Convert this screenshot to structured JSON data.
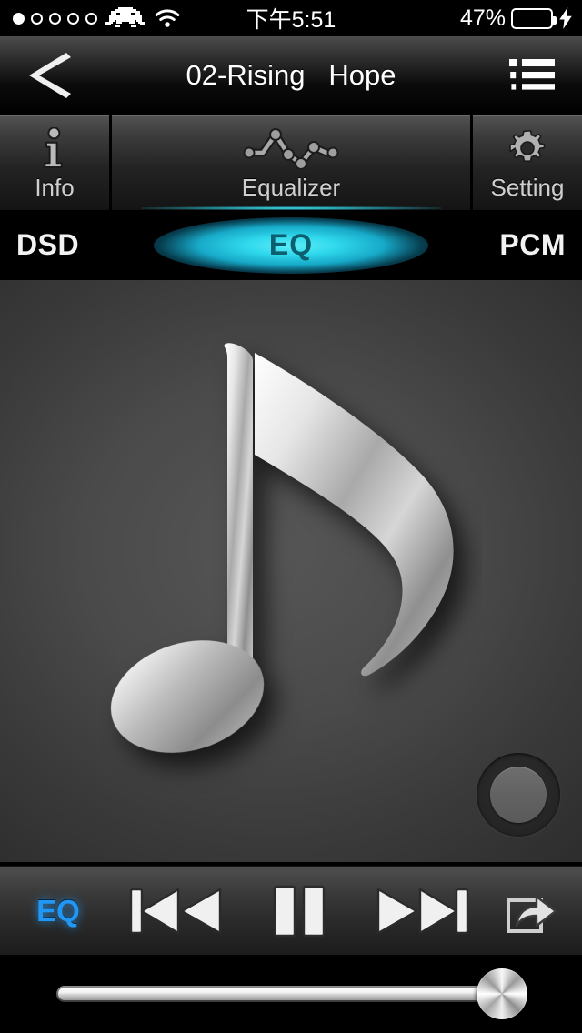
{
  "status_bar": {
    "signal_dots_total": 5,
    "signal_dots_filled": 1,
    "carrier_icon": "space-invader-icon",
    "wifi_icon": "wifi-icon",
    "time": "下午5:51",
    "battery_percent_label": "47%",
    "battery_level": 47,
    "battery_color": "#4cd964",
    "charging_icon": "lightning-bolt-icon"
  },
  "nav_bar": {
    "back_icon": "chevron-left-icon",
    "title": "02-Rising   Hope",
    "playlist_icon": "list-icon"
  },
  "tabs": [
    {
      "id": "info",
      "label": "Info",
      "icon": "info-icon",
      "active": false
    },
    {
      "id": "equalizer",
      "label": "Equalizer",
      "icon": "waveform-icon",
      "active": true
    },
    {
      "id": "setting",
      "label": "Setting",
      "icon": "gear-icon",
      "active": false
    }
  ],
  "format_row": {
    "left_label": "DSD",
    "indicator_label": "EQ",
    "right_label": "PCM",
    "glow_color": "#2fd8ec",
    "indicator_text_color": "#0d5f70"
  },
  "artwork": {
    "icon": "music-note-icon",
    "knob_icon": "round-knob-button"
  },
  "transport": {
    "eq_label": "EQ",
    "eq_color": "#2196f3",
    "prev_icon": "previous-track-icon",
    "play_pause_icon": "pause-icon",
    "next_icon": "next-track-icon",
    "share_icon": "share-icon"
  },
  "slider": {
    "name": "volume-slider",
    "value_percent": 95,
    "thumb_icon": "metal-knob-thumb"
  }
}
